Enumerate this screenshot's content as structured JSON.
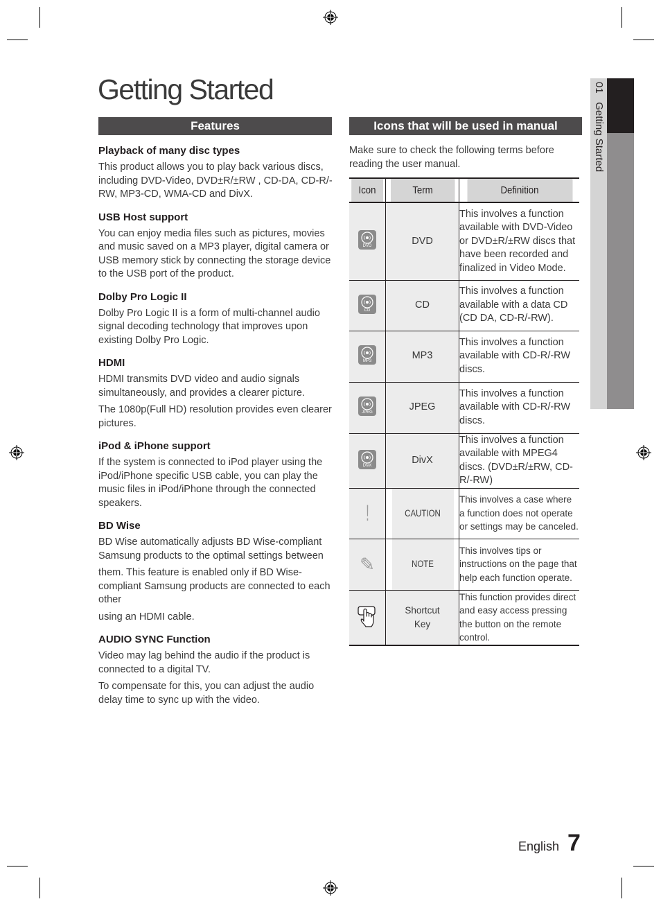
{
  "page": {
    "title": "Getting Started",
    "language": "English",
    "page_number": "7"
  },
  "side_tab": {
    "chapter_number": "01",
    "chapter_title": "Getting Started"
  },
  "features": {
    "heading": "Features",
    "items": [
      {
        "title": "Playback of many disc types",
        "paragraphs": [
          "This product allows you to play back various discs, including DVD-Video, DVD±R/±RW , CD-DA, CD-R/-RW, MP3-CD, WMA-CD and DivX."
        ]
      },
      {
        "title": "USB Host support",
        "paragraphs": [
          "You can enjoy media files such as pictures, movies and music saved on a MP3 player, digital camera or USB memory stick by connecting the storage device to the USB port of the product."
        ]
      },
      {
        "title": "Dolby Pro Logic II",
        "paragraphs": [
          "Dolby Pro Logic II is a form of multi-channel audio signal decoding technology that improves upon existing Dolby Pro Logic."
        ]
      },
      {
        "title": "HDMI",
        "paragraphs": [
          "HDMI transmits DVD video and audio signals simultaneously, and provides a clearer picture.",
          "The 1080p(Full HD) resolution provides even clearer pictures."
        ]
      },
      {
        "title": "iPod & iPhone support",
        "paragraphs": [
          "If the system is connected to iPod player using the iPod/iPhone specific USB cable, you can play the music files in iPod/iPhone through the connected speakers."
        ]
      },
      {
        "title": "BD Wise",
        "paragraphs": [
          "BD Wise automatically adjusts BD Wise-compliant Samsung products to the optimal settings between",
          "them. This feature is enabled only if BD Wise-compliant Samsung products are connected to each other",
          "using an HDMI cable."
        ]
      },
      {
        "title": "AUDIO SYNC Function",
        "paragraphs": [
          "Video may lag behind the audio if the product is connected to a digital TV.",
          "To compensate for this, you can adjust the audio delay time to sync up with the video."
        ]
      }
    ]
  },
  "icons_section": {
    "heading": "Icons that will be used in manual",
    "intro": "Make sure to check the following terms before reading the user manual.",
    "columns": [
      "Icon",
      "Term",
      "Definition"
    ],
    "rows": [
      {
        "icon": "dvd-disc-icon",
        "icon_label": "DVD",
        "term": "DVD",
        "definition": "This involves a function available with DVD-Video or DVD±R/±RW discs that have been recorded and finalized in Video Mode."
      },
      {
        "icon": "cd-disc-icon",
        "icon_label": "CD",
        "term": "CD",
        "definition": "This involves a function available with a data CD (CD DA, CD-R/-RW)."
      },
      {
        "icon": "mp3-disc-icon",
        "icon_label": "MP3",
        "term": "MP3",
        "definition": "This involves a function available with CD-R/-RW discs."
      },
      {
        "icon": "jpeg-disc-icon",
        "icon_label": "JPEG",
        "term": "JPEG",
        "definition": "This involves a function available with CD-R/-RW discs."
      },
      {
        "icon": "divx-disc-icon",
        "icon_label": "DivX",
        "term": "DivX",
        "definition": "This involves a function available with MPEG4 discs. (DVD±R/±RW, CD-R/-RW)"
      },
      {
        "icon": "caution-exclamation-icon",
        "icon_glyph": "!",
        "term": "CAUTION",
        "definition": "This involves a case where a function does not operate or settings may be canceled."
      },
      {
        "icon": "note-pencil-icon",
        "icon_glyph": "✎",
        "term": "NOTE",
        "definition": "This involves tips or instructions on the page that help each function operate."
      },
      {
        "icon": "shortcut-key-hand-icon",
        "term": "Shortcut Key",
        "definition": "This function provides direct and easy access pressing the button on the remote control."
      }
    ]
  }
}
